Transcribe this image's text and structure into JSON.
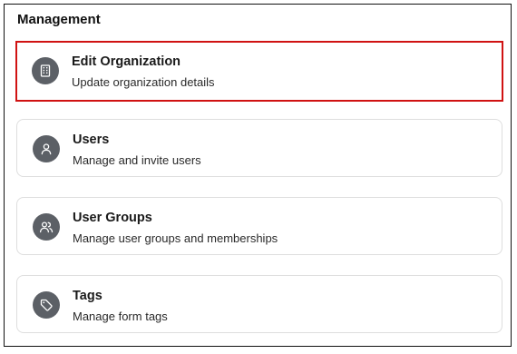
{
  "section": {
    "title": "Management"
  },
  "items": [
    {
      "icon": "building-icon",
      "title": "Edit Organization",
      "description": "Update organization details",
      "selected": true
    },
    {
      "icon": "user-icon",
      "title": "Users",
      "description": "Manage and invite users",
      "selected": false
    },
    {
      "icon": "users-icon",
      "title": "User Groups",
      "description": "Manage user groups and memberships",
      "selected": false
    },
    {
      "icon": "tag-icon",
      "title": "Tags",
      "description": "Manage form tags",
      "selected": false
    }
  ],
  "colors": {
    "selected_border": "#d01212",
    "icon_background": "#5c6066",
    "card_border": "#dedede"
  }
}
